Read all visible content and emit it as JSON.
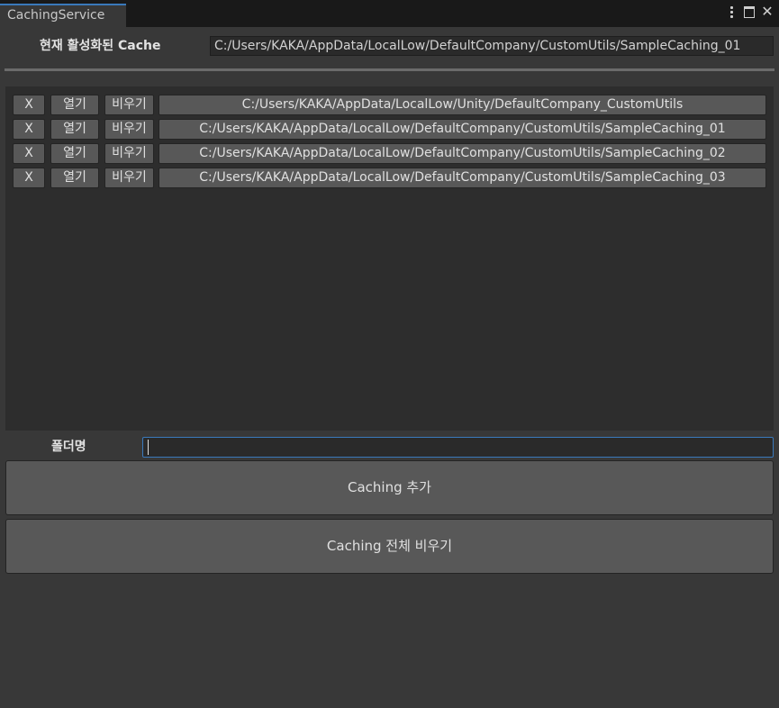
{
  "tab": {
    "title": "CachingService"
  },
  "window_controls": {
    "menu": "kebab-menu-icon",
    "maximize": "maximize-icon",
    "close": "✕"
  },
  "active_cache": {
    "label": "현재 활성화된 Cache",
    "value": "C:/Users/KAKA/AppData/LocalLow/DefaultCompany/CustomUtils/SampleCaching_01"
  },
  "cache_list": [
    {
      "remove": "X",
      "open": "열기",
      "clear": "비우기",
      "path": "C:/Users/KAKA/AppData/LocalLow/Unity/DefaultCompany_CustomUtils"
    },
    {
      "remove": "X",
      "open": "열기",
      "clear": "비우기",
      "path": "C:/Users/KAKA/AppData/LocalLow/DefaultCompany/CustomUtils/SampleCaching_01"
    },
    {
      "remove": "X",
      "open": "열기",
      "clear": "비우기",
      "path": "C:/Users/KAKA/AppData/LocalLow/DefaultCompany/CustomUtils/SampleCaching_02"
    },
    {
      "remove": "X",
      "open": "열기",
      "clear": "비우기",
      "path": "C:/Users/KAKA/AppData/LocalLow/DefaultCompany/CustomUtils/SampleCaching_03"
    }
  ],
  "folder": {
    "label": "폴더명",
    "value": ""
  },
  "actions": {
    "add_label": "Caching 추가",
    "clear_all_label": "Caching 전체 비우기"
  },
  "colors": {
    "background": "#383838",
    "tab_accent": "#3a79bb",
    "button": "#585858",
    "list_bg": "#2d2d2d"
  }
}
